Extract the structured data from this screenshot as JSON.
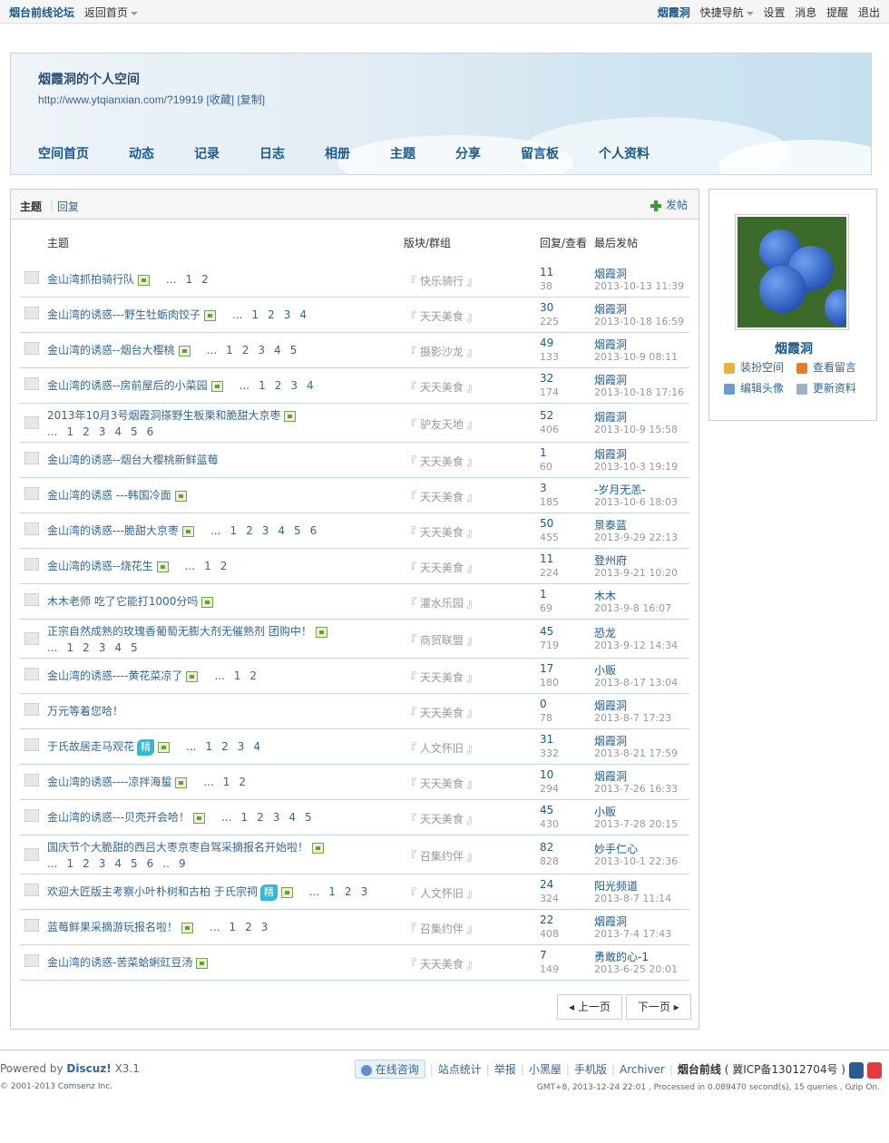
{
  "topbar": {
    "site": "烟台前线论坛",
    "back": "返回首页",
    "user": "烟霞洞",
    "quicknav": "快捷导航",
    "settings": "设置",
    "messages": "消息",
    "remind": "提醒",
    "logout": "退出"
  },
  "header": {
    "title": "烟霞洞的个人空间",
    "url": "http://www.ytqianxian.com/?19919",
    "fav": "[收藏]",
    "copy": "[复制]",
    "nav": [
      "空间首页",
      "动态",
      "记录",
      "日志",
      "相册",
      "主题",
      "分享",
      "留言板",
      "个人资料"
    ]
  },
  "tabs": {
    "topic": "主题",
    "reply": "回复",
    "post": "发帖"
  },
  "thead": {
    "topic": "主题",
    "forum": "版块/群组",
    "rv": "回复/查看",
    "last": "最后发帖"
  },
  "threads": [
    {
      "title": "金山湾抓拍骑行队",
      "img": true,
      "jing": false,
      "pages": [
        "...",
        "1",
        "2"
      ],
      "pages2": [],
      "forum": "『 快乐骑行 』",
      "replies": "11",
      "views": "38",
      "user": "烟霞洞",
      "time": "2013-10-13 11:39"
    },
    {
      "title": "金山湾的诱惑---野生牡蛎肉饺子",
      "img": true,
      "jing": false,
      "pages": [
        "...",
        "1",
        "2",
        "3",
        "4"
      ],
      "pages2": [],
      "forum": "『 天天美食 』",
      "replies": "30",
      "views": "225",
      "user": "烟霞洞",
      "time": "2013-10-18 16:59"
    },
    {
      "title": "金山湾的诱惑--烟台大樱桃",
      "img": true,
      "jing": false,
      "pages": [
        "...",
        "1",
        "2",
        "3",
        "4",
        "5"
      ],
      "pages2": [],
      "forum": "『 摄影沙龙 』",
      "replies": "49",
      "views": "133",
      "user": "烟霞洞",
      "time": "2013-10-9 08:11"
    },
    {
      "title": "金山湾的诱惑--房前屋后的小菜园",
      "img": true,
      "jing": false,
      "pages": [
        "...",
        "1",
        "2",
        "3",
        "4"
      ],
      "pages2": [],
      "forum": "『 天天美食 』",
      "replies": "32",
      "views": "174",
      "user": "烟霞洞",
      "time": "2013-10-18 17:16"
    },
    {
      "title": "2013年10月3号烟霞洞搽野生板栗和脆甜大京枣",
      "img": true,
      "jing": false,
      "pages": [],
      "pages2": [
        "...",
        "1",
        "2",
        "3",
        "4",
        "5",
        "6"
      ],
      "forum": "『 驴友天地 』",
      "replies": "52",
      "views": "406",
      "user": "烟霞洞",
      "time": "2013-10-9 15:58"
    },
    {
      "title": "金山湾的诱惑--烟台大樱桃新鲜蓝莓",
      "img": false,
      "jing": false,
      "pages": [],
      "pages2": [],
      "forum": "『 天天美食 』",
      "replies": "1",
      "views": "60",
      "user": "烟霞洞",
      "time": "2013-10-3 19:19"
    },
    {
      "title": "金山湾的诱惑 ---韩国冷面",
      "img": true,
      "jing": false,
      "pages": [],
      "pages2": [],
      "forum": "『 天天美食 』",
      "replies": "3",
      "views": "185",
      "user": "-岁月无恙-",
      "time": "2013-10-6 18:03"
    },
    {
      "title": "金山湾的诱惑---脆甜大京枣",
      "img": true,
      "jing": false,
      "pages": [
        "...",
        "1",
        "2",
        "3",
        "4",
        "5",
        "6"
      ],
      "pages2": [],
      "forum": "『 天天美食 』",
      "replies": "50",
      "views": "455",
      "user": "景泰蓝",
      "time": "2013-9-29 22:13"
    },
    {
      "title": "金山湾的诱惑--烧花生",
      "img": true,
      "jing": false,
      "pages": [
        "...",
        "1",
        "2"
      ],
      "pages2": [],
      "forum": "『 天天美食 』",
      "replies": "11",
      "views": "224",
      "user": "登州府",
      "time": "2013-9-21 10:20"
    },
    {
      "title": "木木老师 吃了它能打1000分吗",
      "img": true,
      "jing": false,
      "pages": [],
      "pages2": [],
      "forum": "『 灌水乐园 』",
      "replies": "1",
      "views": "69",
      "user": "木木",
      "time": "2013-9-8 16:07"
    },
    {
      "title": "正宗自然成熟的玫瑰香葡萄无膨大剂无催熟剂 团购中！",
      "img": true,
      "jing": false,
      "pages": [],
      "pages2": [
        "...",
        "1",
        "2",
        "3",
        "4",
        "5"
      ],
      "forum": "『 商贸联盟 』",
      "replies": "45",
      "views": "719",
      "user": "恐龙",
      "time": "2013-9-12 14:34"
    },
    {
      "title": "金山湾的诱惑----黄花菜凉了",
      "img": true,
      "jing": false,
      "pages": [
        "...",
        "1",
        "2"
      ],
      "pages2": [],
      "forum": "『 天天美食 』",
      "replies": "17",
      "views": "180",
      "user": "小贩",
      "time": "2013-8-17 13:04"
    },
    {
      "title": "万元等着您哈！",
      "img": false,
      "jing": false,
      "pages": [],
      "pages2": [],
      "forum": "『 天天美食 』",
      "replies": "0",
      "views": "78",
      "user": "烟霞洞",
      "time": "2013-8-7 17:23"
    },
    {
      "title": "于氏故居走马观花",
      "img": true,
      "jing": true,
      "pages": [
        "...",
        "1",
        "2",
        "3",
        "4"
      ],
      "pages2": [],
      "forum": "『 人文怀旧 』",
      "replies": "31",
      "views": "332",
      "user": "烟霞洞",
      "time": "2013-8-21 17:59"
    },
    {
      "title": "金山湾的诱惑----凉拌海蜇",
      "img": true,
      "jing": false,
      "pages": [
        "...",
        "1",
        "2"
      ],
      "pages2": [],
      "forum": "『 天天美食 』",
      "replies": "10",
      "views": "294",
      "user": "烟霞洞",
      "time": "2013-7-26 16:33"
    },
    {
      "title": "金山湾的诱惑---贝壳开会哈！",
      "img": true,
      "jing": false,
      "pages": [
        "...",
        "1",
        "2",
        "3",
        "4",
        "5"
      ],
      "pages2": [],
      "forum": "『 天天美食 』",
      "replies": "45",
      "views": "430",
      "user": "小贩",
      "time": "2013-7-28 20:15"
    },
    {
      "title": "国庆节个大脆甜的西吕大枣京枣自驾采摘报名开始啦！",
      "img": true,
      "jing": false,
      "pages": [],
      "pages2": [
        "...",
        "1",
        "2",
        "3",
        "4",
        "5",
        "6",
        "..",
        "9"
      ],
      "forum": "『 召集约伴 』",
      "replies": "82",
      "views": "828",
      "user": "妙手仁心",
      "time": "2013-10-1 22:36"
    },
    {
      "title": "欢迎大匠版主考察小叶朴树和古柏 于氏宗祠",
      "img": true,
      "jing": true,
      "pages": [
        "...",
        "1",
        "2",
        "3"
      ],
      "pages2": [],
      "forum": "『 人文怀旧 』",
      "replies": "24",
      "views": "324",
      "user": "阳光频道",
      "time": "2013-8-7 11:14"
    },
    {
      "title": "蓝莓鲜果采摘游玩报名啦！",
      "img": true,
      "jing": false,
      "pages": [
        "...",
        "1",
        "2",
        "3"
      ],
      "pages2": [],
      "forum": "『 召集约伴 』",
      "replies": "22",
      "views": "408",
      "user": "烟霞洞",
      "time": "2013-7-4 17:43"
    },
    {
      "title": "金山湾的诱惑-苦菜蛤蜊豇豆汤",
      "img": true,
      "jing": false,
      "pages": [],
      "pages2": [],
      "forum": "『 天天美食 』",
      "replies": "7",
      "views": "149",
      "user": "勇敢的心-1",
      "time": "2013-6-25 20:01"
    }
  ],
  "jing_label": "精",
  "pager": {
    "prev": "上一页",
    "next": "下一页"
  },
  "side": {
    "name": "烟霞洞",
    "links": [
      "装扮空间",
      "查看留言",
      "编辑头像",
      "更新资料"
    ]
  },
  "footer": {
    "powered": "Powered by",
    "discuz": "Discuz!",
    "ver": "X3.1",
    "copyright": "© 2001-2013",
    "comsenz": "Comsenz Inc.",
    "chat": "在线咨询",
    "links": [
      "站点统计",
      "举报",
      "小黑屋",
      "手机版",
      "Archiver"
    ],
    "site": "烟台前线",
    "icp": "( 冀ICP备13012704号 )",
    "gmt": "GMT+8, 2013-12-24 22:01 , Processed in 0.089470 second(s), 15 queries , Gzip On."
  }
}
